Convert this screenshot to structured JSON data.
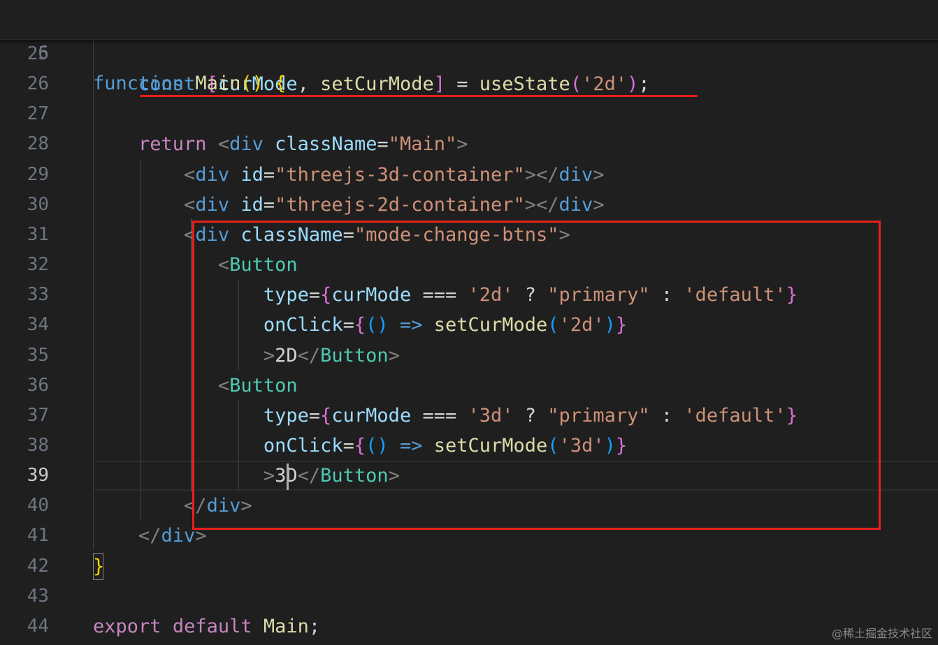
{
  "editor": {
    "sticky_line": {
      "number": "6",
      "tokens": [
        {
          "t": "function",
          "c": "kw-b"
        },
        {
          "t": " ",
          "c": "txt"
        },
        {
          "t": "Main",
          "c": "fn"
        },
        {
          "t": "()",
          "c": "br1"
        },
        {
          "t": " ",
          "c": "txt"
        },
        {
          "t": "{",
          "c": "br1"
        }
      ]
    },
    "lines": [
      {
        "number": "25",
        "tokens": []
      },
      {
        "number": "26",
        "tokens": [
          {
            "t": "    ",
            "c": "txt"
          },
          {
            "t": "const",
            "c": "kw-b"
          },
          {
            "t": " ",
            "c": "txt"
          },
          {
            "t": "[",
            "c": "br2"
          },
          {
            "t": "curMode",
            "c": "var"
          },
          {
            "t": ", ",
            "c": "txt"
          },
          {
            "t": "setCurMode",
            "c": "fn"
          },
          {
            "t": "]",
            "c": "br2"
          },
          {
            "t": " = ",
            "c": "op"
          },
          {
            "t": "useState",
            "c": "fn"
          },
          {
            "t": "(",
            "c": "br2"
          },
          {
            "t": "'2d'",
            "c": "str"
          },
          {
            "t": ")",
            "c": "br2"
          },
          {
            "t": ";",
            "c": "txt"
          }
        ]
      },
      {
        "number": "27",
        "tokens": []
      },
      {
        "number": "28",
        "tokens": [
          {
            "t": "    ",
            "c": "txt"
          },
          {
            "t": "return",
            "c": "kw-c"
          },
          {
            "t": " ",
            "c": "txt"
          },
          {
            "t": "<",
            "c": "punc"
          },
          {
            "t": "div",
            "c": "tag"
          },
          {
            "t": " ",
            "c": "txt"
          },
          {
            "t": "className",
            "c": "attr"
          },
          {
            "t": "=",
            "c": "op"
          },
          {
            "t": "\"Main\"",
            "c": "str"
          },
          {
            "t": ">",
            "c": "punc"
          }
        ]
      },
      {
        "number": "29",
        "tokens": [
          {
            "t": "        ",
            "c": "txt"
          },
          {
            "t": "<",
            "c": "punc"
          },
          {
            "t": "div",
            "c": "tag"
          },
          {
            "t": " ",
            "c": "txt"
          },
          {
            "t": "id",
            "c": "attr"
          },
          {
            "t": "=",
            "c": "op"
          },
          {
            "t": "\"threejs-3d-container\"",
            "c": "str"
          },
          {
            "t": "></",
            "c": "punc"
          },
          {
            "t": "div",
            "c": "tag"
          },
          {
            "t": ">",
            "c": "punc"
          }
        ]
      },
      {
        "number": "30",
        "tokens": [
          {
            "t": "        ",
            "c": "txt"
          },
          {
            "t": "<",
            "c": "punc"
          },
          {
            "t": "div",
            "c": "tag"
          },
          {
            "t": " ",
            "c": "txt"
          },
          {
            "t": "id",
            "c": "attr"
          },
          {
            "t": "=",
            "c": "op"
          },
          {
            "t": "\"threejs-2d-container\"",
            "c": "str"
          },
          {
            "t": "></",
            "c": "punc"
          },
          {
            "t": "div",
            "c": "tag"
          },
          {
            "t": ">",
            "c": "punc"
          }
        ]
      },
      {
        "number": "31",
        "tokens": [
          {
            "t": "        ",
            "c": "txt"
          },
          {
            "t": "<",
            "c": "punc"
          },
          {
            "t": "div",
            "c": "tag"
          },
          {
            "t": " ",
            "c": "txt"
          },
          {
            "t": "className",
            "c": "attr"
          },
          {
            "t": "=",
            "c": "op"
          },
          {
            "t": "\"mode-change-btns\"",
            "c": "str"
          },
          {
            "t": ">",
            "c": "punc"
          }
        ]
      },
      {
        "number": "32",
        "tokens": [
          {
            "t": "           ",
            "c": "txt"
          },
          {
            "t": "<",
            "c": "punc"
          },
          {
            "t": "Button",
            "c": "comp"
          }
        ]
      },
      {
        "number": "33",
        "tokens": [
          {
            "t": "               ",
            "c": "txt"
          },
          {
            "t": "type",
            "c": "attr"
          },
          {
            "t": "=",
            "c": "op"
          },
          {
            "t": "{",
            "c": "br2"
          },
          {
            "t": "curMode",
            "c": "var"
          },
          {
            "t": " === ",
            "c": "op"
          },
          {
            "t": "'2d'",
            "c": "str"
          },
          {
            "t": " ? ",
            "c": "op"
          },
          {
            "t": "\"primary\"",
            "c": "str"
          },
          {
            "t": " : ",
            "c": "op"
          },
          {
            "t": "'default'",
            "c": "str"
          },
          {
            "t": "}",
            "c": "br2"
          }
        ]
      },
      {
        "number": "34",
        "tokens": [
          {
            "t": "               ",
            "c": "txt"
          },
          {
            "t": "onClick",
            "c": "attr"
          },
          {
            "t": "=",
            "c": "op"
          },
          {
            "t": "{",
            "c": "br2"
          },
          {
            "t": "()",
            "c": "br3"
          },
          {
            "t": " ",
            "c": "txt"
          },
          {
            "t": "=>",
            "c": "kw-b"
          },
          {
            "t": " ",
            "c": "txt"
          },
          {
            "t": "setCurMode",
            "c": "fn"
          },
          {
            "t": "(",
            "c": "br3"
          },
          {
            "t": "'2d'",
            "c": "str"
          },
          {
            "t": ")",
            "c": "br3"
          },
          {
            "t": "}",
            "c": "br2"
          }
        ]
      },
      {
        "number": "35",
        "tokens": [
          {
            "t": "               ",
            "c": "txt"
          },
          {
            "t": ">",
            "c": "punc"
          },
          {
            "t": "2D",
            "c": "txt"
          },
          {
            "t": "</",
            "c": "punc"
          },
          {
            "t": "Button",
            "c": "comp"
          },
          {
            "t": ">",
            "c": "punc"
          }
        ]
      },
      {
        "number": "36",
        "tokens": [
          {
            "t": "           ",
            "c": "txt"
          },
          {
            "t": "<",
            "c": "punc"
          },
          {
            "t": "Button",
            "c": "comp"
          }
        ]
      },
      {
        "number": "37",
        "tokens": [
          {
            "t": "               ",
            "c": "txt"
          },
          {
            "t": "type",
            "c": "attr"
          },
          {
            "t": "=",
            "c": "op"
          },
          {
            "t": "{",
            "c": "br2"
          },
          {
            "t": "curMode",
            "c": "var"
          },
          {
            "t": " === ",
            "c": "op"
          },
          {
            "t": "'3d'",
            "c": "str"
          },
          {
            "t": " ? ",
            "c": "op"
          },
          {
            "t": "\"primary\"",
            "c": "str"
          },
          {
            "t": " : ",
            "c": "op"
          },
          {
            "t": "'default'",
            "c": "str"
          },
          {
            "t": "}",
            "c": "br2"
          }
        ]
      },
      {
        "number": "38",
        "tokens": [
          {
            "t": "               ",
            "c": "txt"
          },
          {
            "t": "onClick",
            "c": "attr"
          },
          {
            "t": "=",
            "c": "op"
          },
          {
            "t": "{",
            "c": "br2"
          },
          {
            "t": "()",
            "c": "br3"
          },
          {
            "t": " ",
            "c": "txt"
          },
          {
            "t": "=>",
            "c": "kw-b"
          },
          {
            "t": " ",
            "c": "txt"
          },
          {
            "t": "setCurMode",
            "c": "fn"
          },
          {
            "t": "(",
            "c": "br3"
          },
          {
            "t": "'3d'",
            "c": "str"
          },
          {
            "t": ")",
            "c": "br3"
          },
          {
            "t": "}",
            "c": "br2"
          }
        ]
      },
      {
        "number": "39",
        "current": true,
        "tokens": [
          {
            "t": "               ",
            "c": "txt"
          },
          {
            "t": ">",
            "c": "punc"
          },
          {
            "t": "3D",
            "c": "txt"
          },
          {
            "t": "</",
            "c": "punc"
          },
          {
            "t": "Button",
            "c": "comp"
          },
          {
            "t": ">",
            "c": "punc"
          }
        ]
      },
      {
        "number": "40",
        "tokens": [
          {
            "t": "        ",
            "c": "txt"
          },
          {
            "t": "</",
            "c": "punc"
          },
          {
            "t": "div",
            "c": "tag"
          },
          {
            "t": ">",
            "c": "punc"
          }
        ]
      },
      {
        "number": "41",
        "tokens": [
          {
            "t": "    ",
            "c": "txt"
          },
          {
            "t": "</",
            "c": "punc"
          },
          {
            "t": "div",
            "c": "tag"
          },
          {
            "t": ">",
            "c": "punc"
          }
        ]
      },
      {
        "number": "42",
        "tokens": [
          {
            "t": "}",
            "c": "br1"
          }
        ]
      },
      {
        "number": "43",
        "tokens": []
      },
      {
        "number": "44",
        "tokens": [
          {
            "t": "export",
            "c": "kw-c"
          },
          {
            "t": " ",
            "c": "txt"
          },
          {
            "t": "default",
            "c": "kw-c"
          },
          {
            "t": " ",
            "c": "txt"
          },
          {
            "t": "Main",
            "c": "fn"
          },
          {
            "t": ";",
            "c": "txt"
          }
        ]
      }
    ]
  },
  "annotations": {
    "highlight_color": "#e8201a"
  },
  "watermark": "@稀土掘金技术社区"
}
